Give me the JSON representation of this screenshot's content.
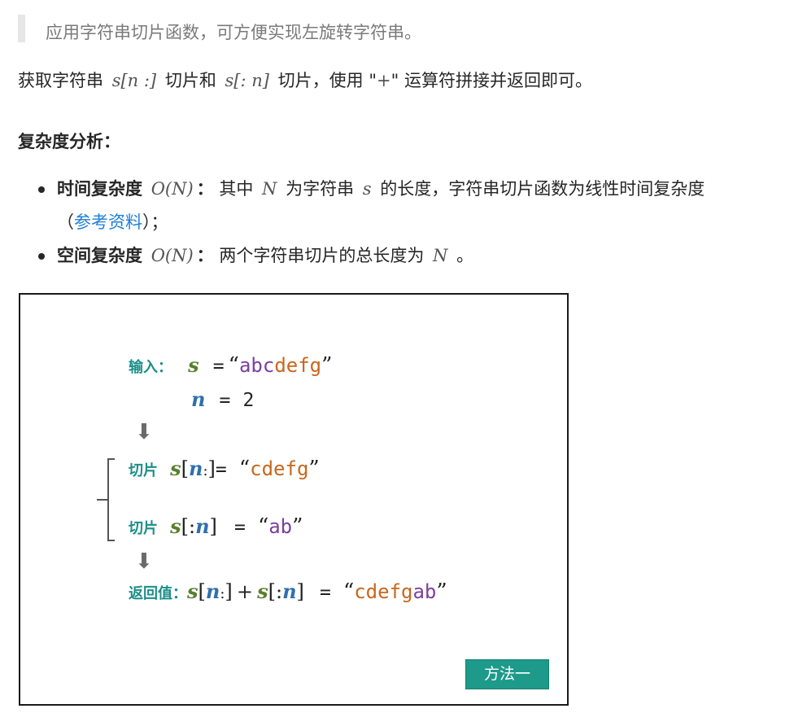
{
  "quote": {
    "text": "应用字符串切片函数，可方便实现左旋转字符串。"
  },
  "para": {
    "p1": "获取字符串",
    "m1": "s[n :]",
    "p2": "切片和",
    "m2": "s[: n]",
    "p3": "切片，使用 \"",
    "plus": "+",
    "p4": "\" 运算符拼接并返回即可。"
  },
  "complexity": {
    "heading": "复杂度分析：",
    "items": [
      {
        "title": "时间复杂度",
        "big_o": "O(N)",
        "colon": "：",
        "pre": "其中",
        "var_n": "N",
        "mid": "为字符串",
        "var_s": "s",
        "post": "的长度，字符串切片函数为线性时间复杂度",
        "paren_open": "（",
        "link": "参考资料",
        "paren_close": "）；"
      },
      {
        "title": "空间复杂度",
        "big_o": "O(N)",
        "colon": "：",
        "pre": "两个字符串切片的总长度为",
        "var_n": "N",
        "post": "。"
      }
    ]
  },
  "figure": {
    "input_label": "输入：",
    "var_s": "s",
    "var_n": "n",
    "equals": "=",
    "open_quote": "“",
    "close_quote": "”",
    "input_str_part1": "abc",
    "input_str_part2": "defg",
    "n_value": "2",
    "arrow": "⬇",
    "slice_label": "切片",
    "slice1_bracket_open": "[",
    "slice1_colon": ":",
    "slice1_bracket_close": "]",
    "slice1_value": "cdefg",
    "slice2_bracket_open": "[:",
    "slice2_bracket_close": "]",
    "slice2_value": "ab",
    "return_label": "返回值：",
    "plus": "+",
    "return_value_part1": "cdefg",
    "return_value_part2": "ab",
    "method_button": "方法一",
    "colors": {
      "label": "#1b8f88",
      "var_s": "#5b7f2f",
      "var_n": "#2f6fae",
      "purple": "#7b3fa0",
      "orange": "#c8671d",
      "button": "#1d9a8a"
    }
  }
}
